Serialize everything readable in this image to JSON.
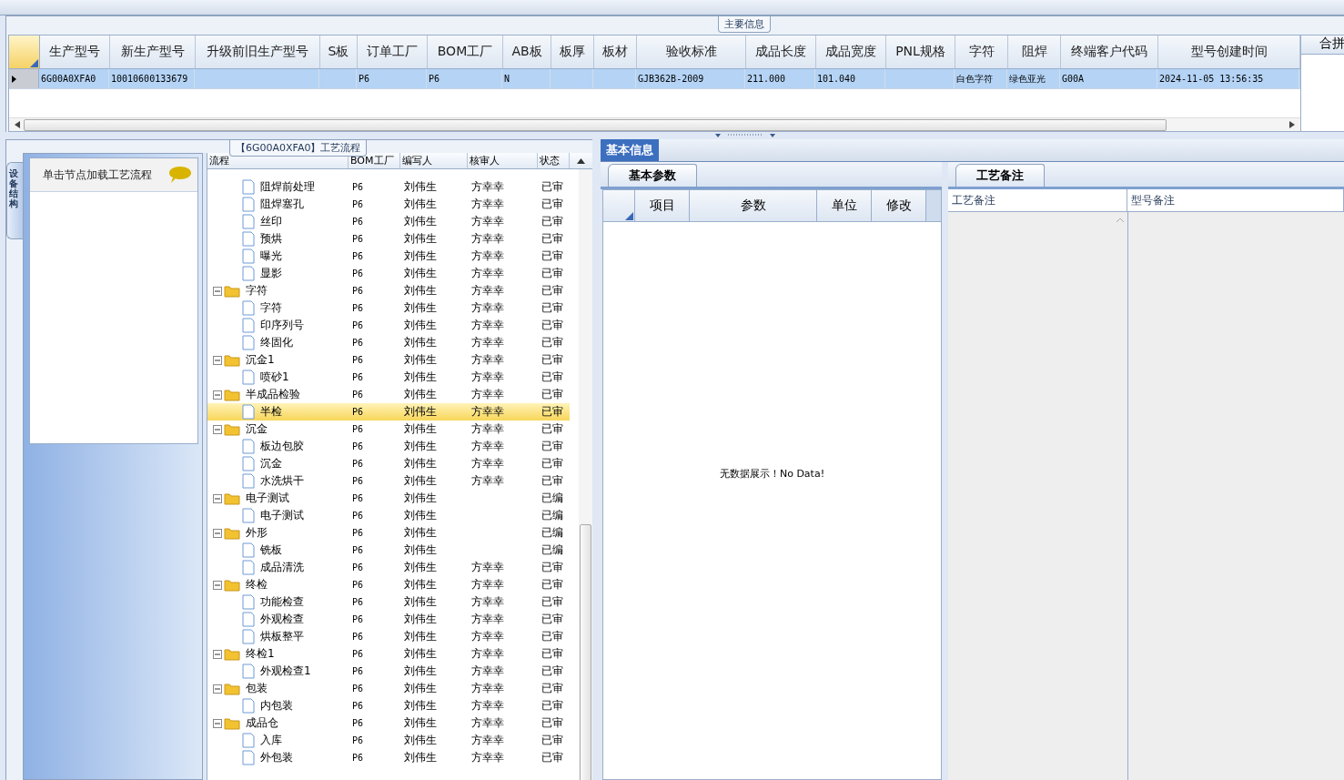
{
  "main_group": {
    "title": "主要信息",
    "columns": [
      "生产型号",
      "新生产型号",
      "升级前旧生产型号",
      "S板",
      "订单工厂",
      "BOM工厂",
      "AB板",
      "板厚",
      "板材",
      "验收标准",
      "成品长度",
      "成品宽度",
      "PNL规格",
      "字符",
      "阻焊",
      "终端客户代码",
      "型号创建时间"
    ],
    "rows": [
      {
        "selected": true,
        "cells": [
          "6G00A0XFA0",
          "10010600133679",
          "",
          "",
          "P6",
          "P6",
          "N",
          "",
          "",
          "GJB362B-2009",
          "211.000",
          "101.040",
          "",
          "白色字符",
          "绿色亚光",
          "G00A",
          "2024-11-05 13:56:35"
        ]
      }
    ],
    "side_column": "合拼"
  },
  "process_group": {
    "title": "【6G00A0XFA0】工艺流程",
    "side_tab": "设备结构",
    "hint": "单击节点加载工艺流程",
    "tree": {
      "columns": [
        "流程",
        "BOM工厂",
        "编写人",
        "核审人",
        "状态"
      ],
      "nodes": [
        {
          "children": [
            {
              "kind": "file",
              "name": "阻焊前处理",
              "factory": "P6",
              "writer": "刘伟生",
              "reviewer": "方幸幸",
              "status": "已审",
              "selected": false
            },
            {
              "kind": "file",
              "name": "阻焊塞孔",
              "factory": "P6",
              "writer": "刘伟生",
              "reviewer": "方幸幸",
              "status": "已审",
              "selected": false
            },
            {
              "kind": "file",
              "name": "丝印",
              "factory": "P6",
              "writer": "刘伟生",
              "reviewer": "方幸幸",
              "status": "已审",
              "selected": false
            },
            {
              "kind": "file",
              "name": "预烘",
              "factory": "P6",
              "writer": "刘伟生",
              "reviewer": "方幸幸",
              "status": "已审",
              "selected": false
            },
            {
              "kind": "file",
              "name": "曝光",
              "factory": "P6",
              "writer": "刘伟生",
              "reviewer": "方幸幸",
              "status": "已审",
              "selected": false
            },
            {
              "kind": "file",
              "name": "显影",
              "factory": "P6",
              "writer": "刘伟生",
              "reviewer": "方幸幸",
              "status": "已审",
              "selected": false
            }
          ]
        },
        {
          "kind": "folder",
          "expanded": true,
          "name": "字符",
          "factory": "P6",
          "writer": "刘伟生",
          "reviewer": "方幸幸",
          "status": "已审",
          "selected": false,
          "children": [
            {
              "kind": "file",
              "name": "字符",
              "factory": "P6",
              "writer": "刘伟生",
              "reviewer": "方幸幸",
              "status": "已审",
              "selected": false
            },
            {
              "kind": "file",
              "name": "印序列号",
              "factory": "P6",
              "writer": "刘伟生",
              "reviewer": "方幸幸",
              "status": "已审",
              "selected": false
            },
            {
              "kind": "file",
              "name": "终固化",
              "factory": "P6",
              "writer": "刘伟生",
              "reviewer": "方幸幸",
              "status": "已审",
              "selected": false
            }
          ]
        },
        {
          "kind": "folder",
          "expanded": true,
          "name": "沉金1",
          "factory": "P6",
          "writer": "刘伟生",
          "reviewer": "方幸幸",
          "status": "已审",
          "selected": false,
          "children": [
            {
              "kind": "file",
              "name": "喷砂1",
              "factory": "P6",
              "writer": "刘伟生",
              "reviewer": "方幸幸",
              "status": "已审",
              "selected": false
            }
          ]
        },
        {
          "kind": "folder",
          "expanded": true,
          "name": "半成品检验",
          "factory": "P6",
          "writer": "刘伟生",
          "reviewer": "方幸幸",
          "status": "已审",
          "selected": false,
          "children": [
            {
              "kind": "file",
              "name": "半检",
              "factory": "P6",
              "writer": "刘伟生",
              "reviewer": "方幸幸",
              "status": "已审",
              "selected": true
            }
          ]
        },
        {
          "kind": "folder",
          "expanded": true,
          "name": "沉金",
          "factory": "P6",
          "writer": "刘伟生",
          "reviewer": "方幸幸",
          "status": "已审",
          "selected": false,
          "children": [
            {
              "kind": "file",
              "name": "板边包胶",
              "factory": "P6",
              "writer": "刘伟生",
              "reviewer": "方幸幸",
              "status": "已审",
              "selected": false
            },
            {
              "kind": "file",
              "name": "沉金",
              "factory": "P6",
              "writer": "刘伟生",
              "reviewer": "方幸幸",
              "status": "已审",
              "selected": false
            },
            {
              "kind": "file",
              "name": "水洗烘干",
              "factory": "P6",
              "writer": "刘伟生",
              "reviewer": "方幸幸",
              "status": "已审",
              "selected": false
            }
          ]
        },
        {
          "kind": "folder",
          "expanded": true,
          "name": "电子测试",
          "factory": "P6",
          "writer": "刘伟生",
          "status": "已编",
          "selected": false,
          "children": [
            {
              "kind": "file",
              "name": "电子测试",
              "factory": "P6",
              "writer": "刘伟生",
              "status": "已编",
              "selected": false
            }
          ]
        },
        {
          "kind": "folder",
          "expanded": true,
          "name": "外形",
          "factory": "P6",
          "writer": "刘伟生",
          "status": "已编",
          "selected": false,
          "children": [
            {
              "kind": "file",
              "name": "铣板",
              "factory": "P6",
              "writer": "刘伟生",
              "status": "已编",
              "selected": false
            },
            {
              "kind": "file",
              "name": "成品清洗",
              "factory": "P6",
              "writer": "刘伟生",
              "reviewer": "方幸幸",
              "status": "已审",
              "selected": false
            }
          ]
        },
        {
          "kind": "folder",
          "expanded": true,
          "name": "终检",
          "factory": "P6",
          "writer": "刘伟生",
          "reviewer": "方幸幸",
          "status": "已审",
          "selected": false,
          "children": [
            {
              "kind": "file",
              "name": "功能检查",
              "factory": "P6",
              "writer": "刘伟生",
              "reviewer": "方幸幸",
              "status": "已审",
              "selected": false
            },
            {
              "kind": "file",
              "name": "外观检查",
              "factory": "P6",
              "writer": "刘伟生",
              "reviewer": "方幸幸",
              "status": "已审",
              "selected": false
            },
            {
              "kind": "file",
              "name": "烘板整平",
              "factory": "P6",
              "writer": "刘伟生",
              "reviewer": "方幸幸",
              "status": "已审",
              "selected": false
            }
          ]
        },
        {
          "kind": "folder",
          "expanded": true,
          "name": "终检1",
          "factory": "P6",
          "writer": "刘伟生",
          "reviewer": "方幸幸",
          "status": "已审",
          "selected": false,
          "children": [
            {
              "kind": "file",
              "name": "外观检查1",
              "factory": "P6",
              "writer": "刘伟生",
              "reviewer": "方幸幸",
              "status": "已审",
              "selected": false
            }
          ]
        },
        {
          "kind": "folder",
          "expanded": true,
          "name": "包装",
          "factory": "P6",
          "writer": "刘伟生",
          "reviewer": "方幸幸",
          "status": "已审",
          "selected": false,
          "children": [
            {
              "kind": "file",
              "name": "内包装",
              "factory": "P6",
              "writer": "刘伟生",
              "reviewer": "方幸幸",
              "status": "已审",
              "selected": false
            }
          ]
        },
        {
          "kind": "folder",
          "expanded": true,
          "name": "成品仓",
          "factory": "P6",
          "writer": "刘伟生",
          "reviewer": "方幸幸",
          "status": "已审",
          "selected": false,
          "children": [
            {
              "kind": "file",
              "name": "入库",
              "factory": "P6",
              "writer": "刘伟生",
              "reviewer": "方幸幸",
              "status": "已审",
              "selected": false
            },
            {
              "kind": "file",
              "name": "外包装",
              "factory": "P6",
              "writer": "刘伟生",
              "reviewer": "方幸幸",
              "status": "已审",
              "selected": false
            }
          ]
        }
      ]
    }
  },
  "info_tab": {
    "label": "基本信息",
    "selected": true
  },
  "params": {
    "tab": "基本参数",
    "columns": [
      "项目",
      "参数",
      "单位",
      "修改"
    ],
    "empty_message": "无数据展示！No Data!"
  },
  "remarks": {
    "tab": "工艺备注",
    "columns": [
      "工艺备注",
      "型号备注"
    ]
  }
}
